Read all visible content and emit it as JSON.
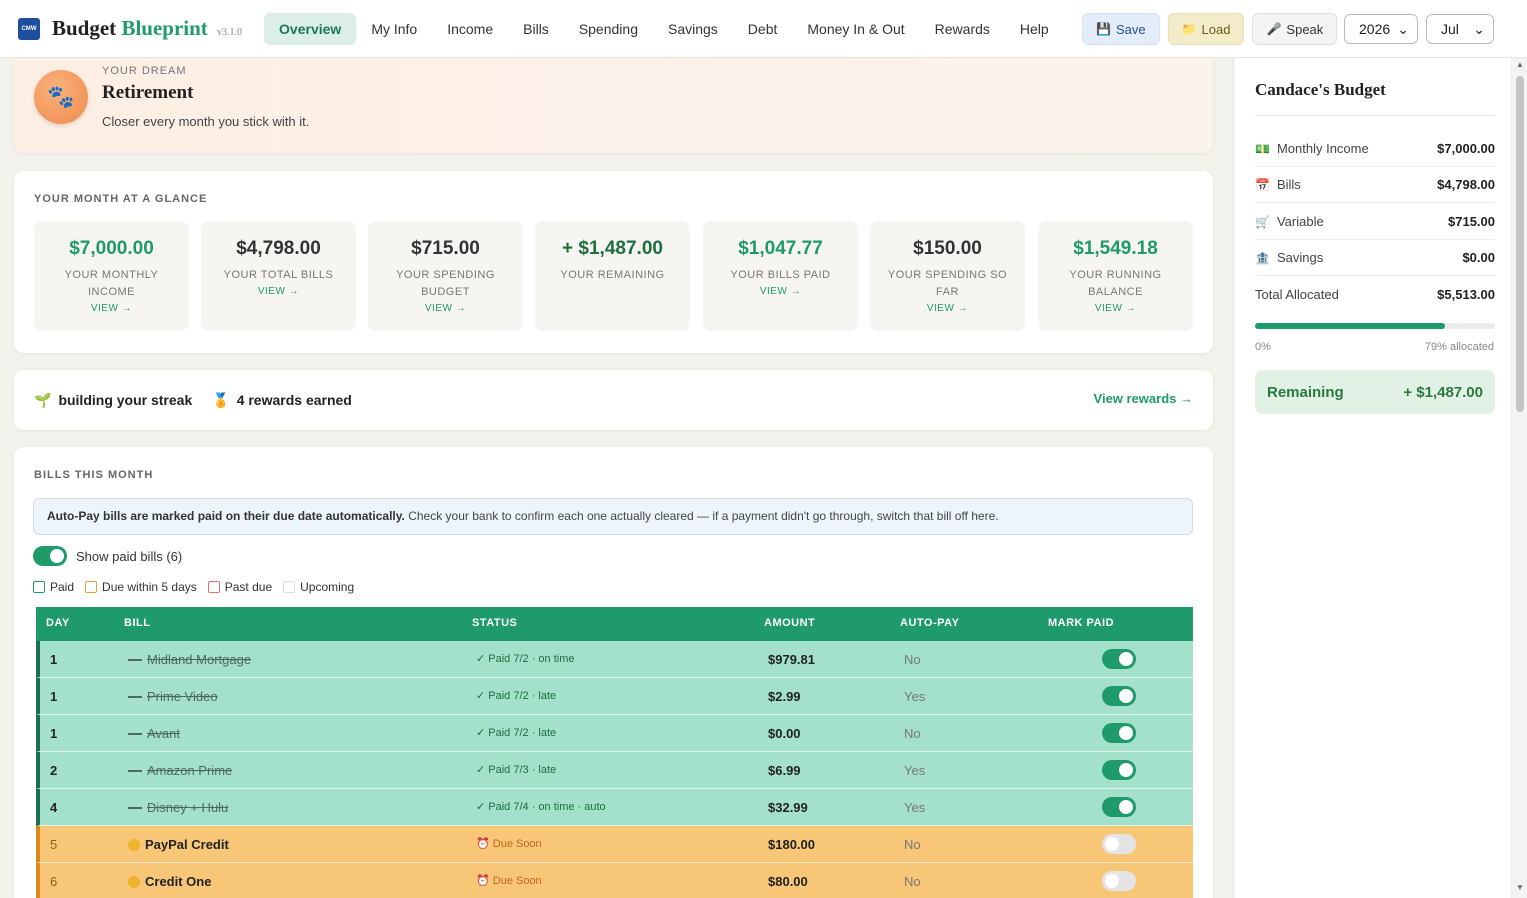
{
  "header": {
    "logo_text": "CMW",
    "brand_main": "Budget",
    "brand_accent": "Blueprint",
    "version": "v3.1.0",
    "nav": [
      "Overview",
      "My Info",
      "Income",
      "Bills",
      "Spending",
      "Savings",
      "Debt",
      "Money In & Out",
      "Rewards",
      "Help"
    ],
    "save_label": "Save",
    "load_label": "Load",
    "speak_label": "Speak",
    "year": "2026",
    "month": "Jul"
  },
  "dream": {
    "label": "YOUR DREAM",
    "title": "Retirement",
    "subtitle": "Closer every month you stick with it.",
    "icon": "paw-icon"
  },
  "glance": {
    "label": "YOUR MONTH AT A GLANCE",
    "stats": [
      {
        "value": "$7,000.00",
        "label": "YOUR MONTHLY INCOME",
        "link": "VIEW →",
        "color": "green"
      },
      {
        "value": "$4,798.00",
        "label": "YOUR TOTAL BILLS",
        "link": "VIEW →",
        "color": "default"
      },
      {
        "value": "$715.00",
        "label": "YOUR SPENDING BUDGET",
        "link": "VIEW →",
        "color": "default"
      },
      {
        "value": "+ $1,487.00",
        "label": "YOUR REMAINING",
        "link": "",
        "color": "dark"
      },
      {
        "value": "$1,047.77",
        "label": "YOUR BILLS PAID",
        "link": "VIEW →",
        "color": "green"
      },
      {
        "value": "$150.00",
        "label": "YOUR SPENDING SO FAR",
        "link": "VIEW →",
        "color": "default"
      },
      {
        "value": "$1,549.18",
        "label": "YOUR RUNNING BALANCE",
        "link": "VIEW →",
        "color": "green"
      }
    ]
  },
  "streak": {
    "streak_text": "building your streak",
    "rewards_text": "4 rewards earned",
    "link": "View rewards →"
  },
  "bills": {
    "label": "BILLS THIS MONTH",
    "notice_bold": "Auto-Pay bills are marked paid on their due date automatically.",
    "notice_rest": " Check your bank to confirm each one actually cleared — if a payment didn't go through, switch that bill off here.",
    "toggle_label": "Show paid bills (6)",
    "legend": [
      "Paid",
      "Due within 5 days",
      "Past due",
      "Upcoming"
    ],
    "columns": [
      "DAY",
      "BILL",
      "STATUS",
      "AMOUNT",
      "AUTO-PAY",
      "MARK PAID"
    ],
    "rows": [
      {
        "day": "1",
        "bill": "Midland Mortgage",
        "status": "✓ Paid 7/2 · on time",
        "amount": "$979.81",
        "autopay": "No",
        "paid": true
      },
      {
        "day": "1",
        "bill": "Prime Video",
        "status": "✓ Paid 7/2 · late",
        "amount": "$2.99",
        "autopay": "Yes",
        "paid": true
      },
      {
        "day": "1",
        "bill": "Avant",
        "status": "✓ Paid 7/2 · late",
        "amount": "$0.00",
        "autopay": "No",
        "paid": true
      },
      {
        "day": "2",
        "bill": "Amazon Prime",
        "status": "✓ Paid 7/3 · late",
        "amount": "$6.99",
        "autopay": "Yes",
        "paid": true
      },
      {
        "day": "4",
        "bill": "Disney + Hulu",
        "status": "✓ Paid 7/4 · on time · auto",
        "amount": "$32.99",
        "autopay": "Yes",
        "paid": true
      },
      {
        "day": "5",
        "bill": "PayPal Credit",
        "status": "⏰ Due Soon",
        "amount": "$180.00",
        "autopay": "No",
        "paid": false
      },
      {
        "day": "6",
        "bill": "Credit One",
        "status": "⏰ Due Soon",
        "amount": "$80.00",
        "autopay": "No",
        "paid": false
      }
    ]
  },
  "sidebar": {
    "title": "Candace's Budget",
    "rows": [
      {
        "icon": "💵",
        "label": "Monthly Income",
        "value": "$7,000.00"
      },
      {
        "icon": "📅",
        "label": "Bills",
        "value": "$4,798.00"
      },
      {
        "icon": "🛒",
        "label": "Variable",
        "value": "$715.00"
      },
      {
        "icon": "🏦",
        "label": "Savings",
        "value": "$0.00"
      },
      {
        "icon": "",
        "label": "Total Allocated",
        "value": "$5,513.00"
      }
    ],
    "progress_pct": 79,
    "progress_min": "0%",
    "progress_label": "79% allocated",
    "remaining_label": "Remaining",
    "remaining_value": "+ $1,487.00"
  }
}
